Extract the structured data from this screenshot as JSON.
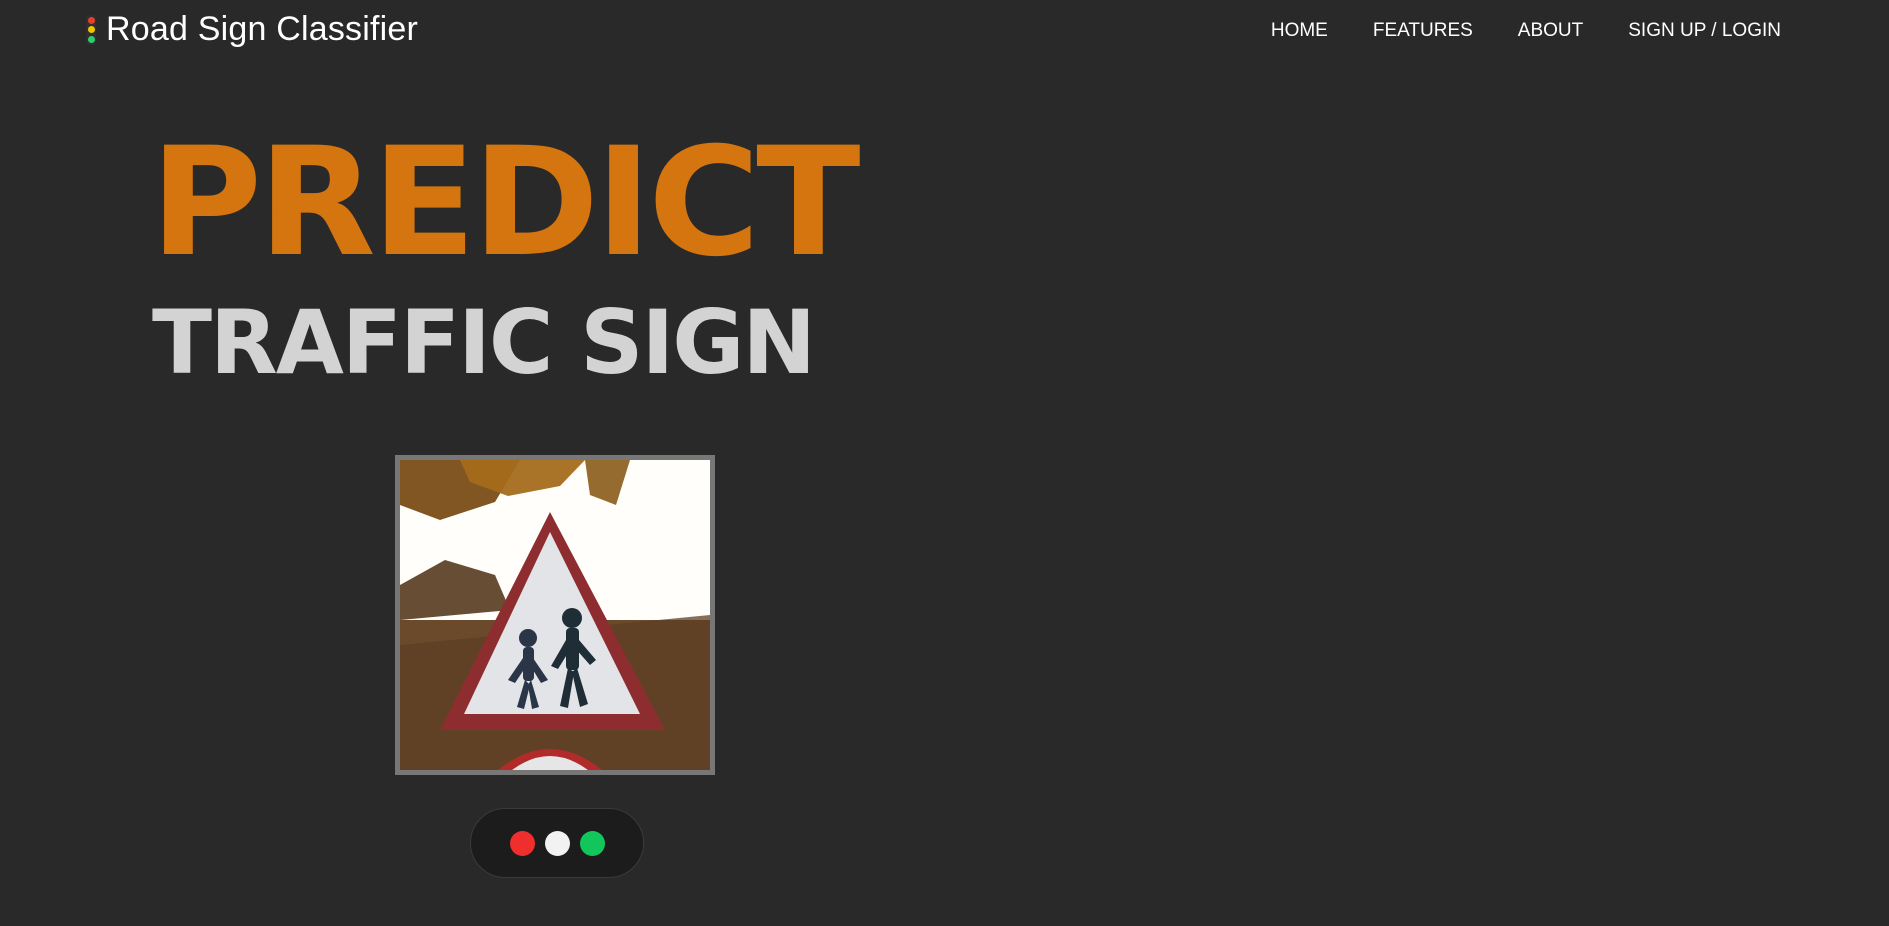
{
  "brand": {
    "title": "Road Sign Classifier",
    "icon": "traffic-light-icon"
  },
  "nav": {
    "links": [
      "HOME",
      "FEATURES",
      "ABOUT",
      "SIGN UP / LOGIN"
    ]
  },
  "hero": {
    "title": "PREDICT",
    "subtitle": "TRAFFIC SIGN"
  },
  "image": {
    "alt": "children crossing warning sign"
  },
  "status_lights": {
    "colors": [
      "#ef2e2e",
      "#f2f2f2",
      "#12c65b"
    ]
  },
  "colors": {
    "background": "#292929",
    "accent": "#d4750f",
    "subtitle": "#d3d3d3",
    "frame": "#777777"
  }
}
